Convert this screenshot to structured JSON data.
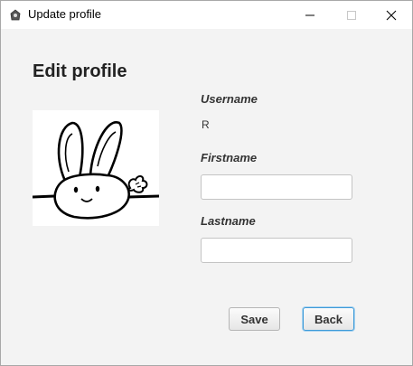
{
  "window": {
    "title": "Update profile",
    "controls": {
      "minimize": "minimize",
      "maximize": "maximize",
      "close": "close"
    }
  },
  "profile": {
    "heading": "Edit profile",
    "username_label": "Username",
    "username_value": "R",
    "firstname_label": "Firstname",
    "firstname_value": "",
    "lastname_label": "Lastname",
    "lastname_value": ""
  },
  "actions": {
    "save_label": "Save",
    "back_label": "Back"
  },
  "icons": {
    "app": "app-icon",
    "avatar": "bunny-avatar-image"
  },
  "colors": {
    "focus_border": "#3d9ad8",
    "window_bg": "#f3f3f3"
  }
}
